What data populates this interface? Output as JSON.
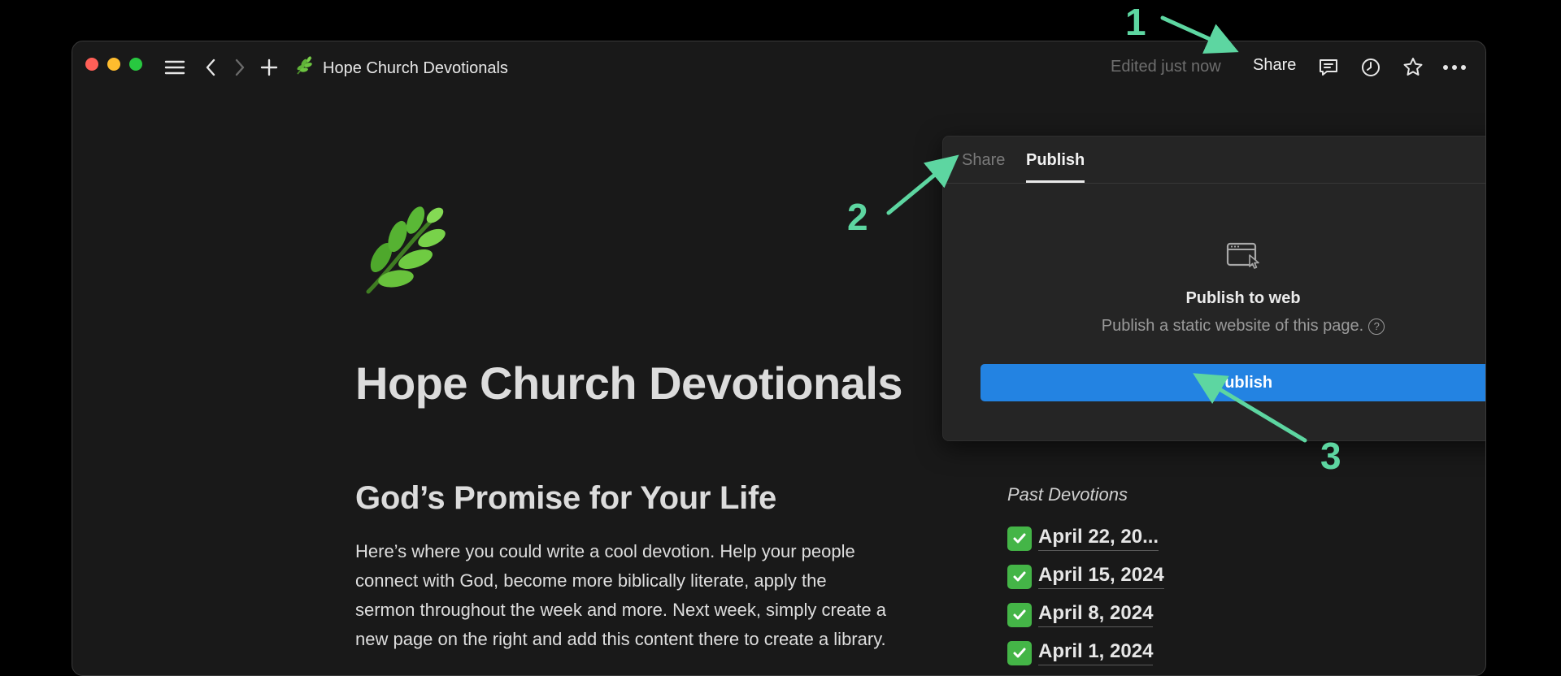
{
  "window": {
    "page_title": "Hope Church Devotionals",
    "edited_status": "Edited just now",
    "share_label": "Share"
  },
  "page": {
    "title": "Hope Church Devotionals",
    "heading": "God’s Promise for Your Life",
    "body_lines": [
      "Here’s where you could write a cool devotion. Help your people",
      "connect with God, become more biblically literate, apply the",
      "sermon throughout the week and more. Next week, simply create a",
      "new page on the right and add this content there to create a library."
    ],
    "past_heading": "Past Devotions",
    "past_items": [
      "April 22, 20...",
      "April 15, 2024",
      "April 8, 2024",
      "April 1, 2024"
    ]
  },
  "popover": {
    "tab_share": "Share",
    "tab_publish": "Publish",
    "title": "Publish to web",
    "description": "Publish a static website of this page.",
    "help": "?",
    "button": "Publish"
  },
  "annotations": [
    "1",
    "2",
    "3"
  ],
  "colors": {
    "accent_blue": "#2383e2",
    "annotation_green": "#5dd6a1",
    "background": "#191919"
  }
}
